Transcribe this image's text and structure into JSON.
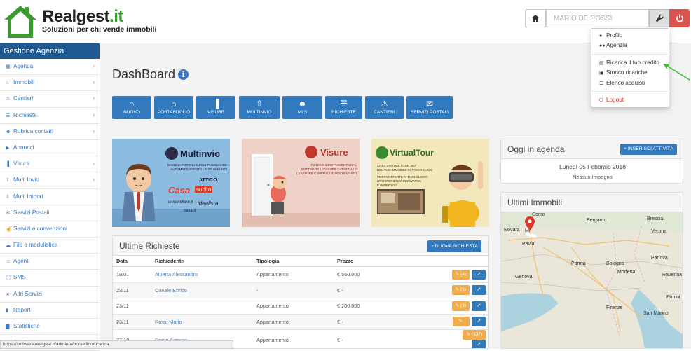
{
  "header": {
    "logo_title": "Realgest",
    "logo_title_suffix": ".it",
    "logo_subtitle": "Soluzioni per chi vende immobili",
    "user_placeholder": "MARIO DE ROSSI"
  },
  "user_menu": {
    "items": [
      {
        "label": "Profilo",
        "icon": "user-icon"
      },
      {
        "label": "Agenzia",
        "icon": "users-icon"
      },
      {
        "label": "Ricarica il tuo credito",
        "icon": "credit-card-icon"
      },
      {
        "label": "Storico ricariche",
        "icon": "inbox-icon"
      },
      {
        "label": "Elenco acquisti",
        "icon": "list-icon"
      },
      {
        "label": "Logout",
        "icon": "power-icon"
      }
    ]
  },
  "sidebar": {
    "title": "Gestione Agenzia",
    "items": [
      {
        "label": "Agenda",
        "icon": "calendar-icon",
        "chevron": true
      },
      {
        "label": "Immobili",
        "icon": "home-icon",
        "chevron": true
      },
      {
        "label": "Cantieri",
        "icon": "warning-icon",
        "chevron": true
      },
      {
        "label": "Richieste",
        "icon": "list-icon",
        "chevron": true
      },
      {
        "label": "Rubrica contatti",
        "icon": "users-icon",
        "chevron": true
      },
      {
        "label": "Annunci",
        "icon": "bullhorn-icon",
        "chevron": false
      },
      {
        "label": "Visure",
        "icon": "barcode-icon",
        "chevron": true
      },
      {
        "label": "Multi Invio",
        "icon": "upload-icon",
        "chevron": true
      },
      {
        "label": "Multi Import",
        "icon": "download-icon",
        "chevron": false
      },
      {
        "label": "Servizi Postali",
        "icon": "envelope-icon",
        "chevron": false
      },
      {
        "label": "Servizi e convenzioni",
        "icon": "thumbs-up-icon",
        "chevron": false
      },
      {
        "label": "File e modulistica",
        "icon": "cloud-icon",
        "chevron": false
      },
      {
        "label": "Agenti",
        "icon": "user-icon",
        "chevron": false
      },
      {
        "label": "SMS",
        "icon": "comment-icon",
        "chevron": false
      },
      {
        "label": "Altri Servizi",
        "icon": "star-icon",
        "chevron": false
      },
      {
        "label": "Report",
        "icon": "file-icon",
        "chevron": false
      },
      {
        "label": "Statistiche",
        "icon": "bar-chart-icon",
        "chevron": false
      },
      {
        "label": "Gestione",
        "icon": "cog-icon",
        "chevron": true
      }
    ]
  },
  "dashboard": {
    "title": "DashBoard",
    "toolbar": [
      {
        "label": "NUOVO",
        "icon": "home-icon"
      },
      {
        "label": "PORTAFOGLIO",
        "icon": "home-icon"
      },
      {
        "label": "VISURE",
        "icon": "barcode-icon"
      },
      {
        "label": "MULTINVIO",
        "icon": "upload-icon"
      },
      {
        "label": "MLS",
        "icon": "users-icon"
      },
      {
        "label": "RICHIESTE",
        "icon": "list-icon"
      },
      {
        "label": "CANTIERI",
        "icon": "warning-icon"
      },
      {
        "label": "SERVIZI POSTALI",
        "icon": "envelope-icon"
      }
    ]
  },
  "banners": {
    "multinvio": {
      "title": "Multinvio",
      "text1": "SCEGLI I PORTALI SU CUI PUBBLICARE",
      "text2": "AUTOMATICAMENTE I TUOI ANNUNCI",
      "logo1": "Casa",
      "logo1b": "subito",
      "logo2": "ATTICO.",
      "logo3": "immobiliare.it",
      "logo4": "idealista",
      "logo5": "casa.it"
    },
    "visure": {
      "title": "Visure",
      "text1": "RICHIEDI DIRETTAMENTE DAL",
      "text2": "SOFTWARE LE VISURE CATASTALI E",
      "text3": "LE VISURE CAMERALI IN POCHI MINUTI"
    },
    "virtualtour": {
      "title": "VirtualTour",
      "text1": "CREA VIRTUAL TOUR 360°",
      "text2": "DEL TUO IMMOBILE IN POCHI CLICK!",
      "text3": "PORTA OFFERTE AI TUOI CLIENTI",
      "text4": "UN'ESPERIENZA INNOVATIVA",
      "text5": "E IMMERSIVA"
    }
  },
  "agenda": {
    "title": "Oggi in agenda",
    "add_button": "INSERISCI ATTIVITÀ",
    "date": "Lunedì 05 Febbraio 2018",
    "empty_text": "Nessun Impegno"
  },
  "immobili": {
    "title": "Ultimi Immobili",
    "cities": [
      "Como",
      "Bergamo",
      "Brescia",
      "Novara",
      "Mi",
      "Pavia",
      "Verona",
      "Padova",
      "Genova",
      "Parma",
      "Modena",
      "Bologna",
      "Ravenna",
      "Firenze",
      "San Marino",
      "Rimini"
    ]
  },
  "richieste": {
    "title": "Ultime Richieste",
    "new_button": "NUOVA RICHIESTA",
    "columns": [
      "Data",
      "Richiedente",
      "Tipologia",
      "Prezzo"
    ],
    "rows": [
      {
        "data": "19/01",
        "richiedente": "Alberta Alessandro",
        "tipologia": "Appartamento",
        "prezzo": "€ 550.000",
        "badge": "(4)"
      },
      {
        "data": "23/11",
        "richiedente": "Cunale Enrico",
        "tipologia": "-",
        "prezzo": "€ -",
        "badge": "(1)"
      },
      {
        "data": "23/11",
        "richiedente": "",
        "tipologia": "Appartamento",
        "prezzo": "€ 200.000",
        "badge": "(3)"
      },
      {
        "data": "23/11",
        "richiedente": "Rossi Mario",
        "tipologia": "Appartamento",
        "prezzo": "€ -",
        "badge": ""
      },
      {
        "data": "27/10",
        "richiedente": "Conte Antonio",
        "tipologia": "Appartamento",
        "prezzo": "€ -",
        "badge": "(337)"
      }
    ]
  },
  "status_bar": {
    "url": "https://software.realgest.it/admin/a/borsellino/ricarica"
  },
  "colors": {
    "brand_blue": "#3279bd",
    "sidebar_title": "#1f5a92",
    "brand_green": "#3a9a2e",
    "danger": "#d9534f",
    "warning": "#f0ad4e"
  }
}
